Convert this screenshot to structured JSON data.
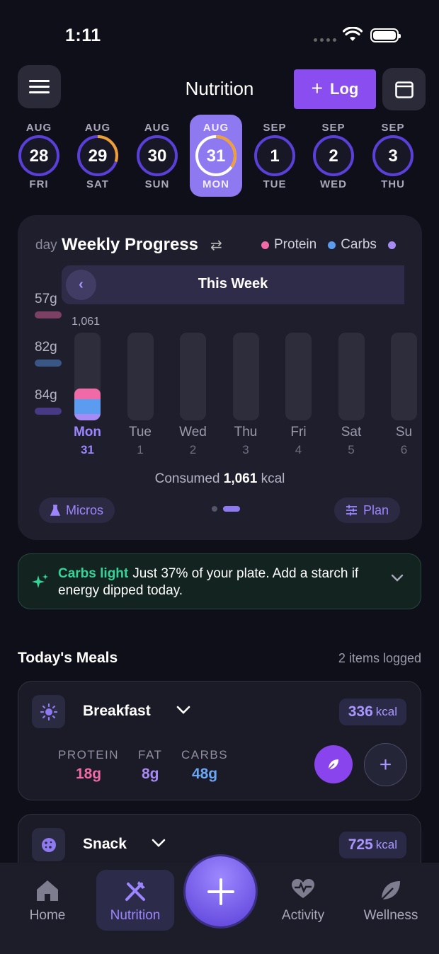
{
  "status_bar": {
    "time": "1:11"
  },
  "header": {
    "title": "Nutrition",
    "log_label": "Log"
  },
  "days": [
    {
      "month": "AUG",
      "day": "28",
      "dow": "FRI",
      "progress": 0.0,
      "active": false
    },
    {
      "month": "AUG",
      "day": "29",
      "dow": "SAT",
      "progress": 0.3,
      "active": false
    },
    {
      "month": "AUG",
      "day": "30",
      "dow": "SUN",
      "progress": 0.0,
      "active": false
    },
    {
      "month": "AUG",
      "day": "31",
      "dow": "MON",
      "progress": 0.35,
      "active": true
    },
    {
      "month": "SEP",
      "day": "1",
      "dow": "TUE",
      "progress": 0.0,
      "active": false
    },
    {
      "month": "SEP",
      "day": "2",
      "dow": "WED",
      "progress": 0.0,
      "active": false
    },
    {
      "month": "SEP",
      "day": "3",
      "dow": "THU",
      "progress": 0.0,
      "active": false
    }
  ],
  "weekly": {
    "cut_label": "day",
    "title": "Weekly Progress",
    "legend": [
      {
        "label": "Protein",
        "color": "#f06aa8"
      },
      {
        "label": "Carbs",
        "color": "#5b9cf0"
      },
      {
        "label": "",
        "color": "#a88af5"
      }
    ],
    "side_values": [
      {
        "label": "57g",
        "color": "#f06aa8"
      },
      {
        "label": "82g",
        "color": "#5b9cf0"
      },
      {
        "label": "84g",
        "color": "#7a5af0"
      }
    ],
    "week_label": "This Week",
    "top_value": "1,061",
    "consumed_prefix": "Consumed",
    "consumed_value": "1,061",
    "consumed_unit": "kcal",
    "micros_label": "Micros",
    "plan_label": "Plan"
  },
  "chart_data": {
    "type": "bar",
    "categories": [
      "Mon",
      "Tue",
      "Wed",
      "Thu",
      "Fri",
      "Sat",
      "Su"
    ],
    "dates": [
      "31",
      "1",
      "2",
      "3",
      "4",
      "5",
      "6"
    ],
    "series": [
      {
        "name": "Protein",
        "values": [
          0.12,
          0,
          0,
          0,
          0,
          0,
          0
        ]
      },
      {
        "name": "Carbs",
        "values": [
          0.17,
          0,
          0,
          0,
          0,
          0,
          0
        ]
      },
      {
        "name": "",
        "values": [
          0.07,
          0,
          0,
          0,
          0,
          0,
          0
        ]
      }
    ],
    "selected": 0
  },
  "tip": {
    "highlight": "Carbs light",
    "text": "Just 37% of your plate. Add a starch if energy dipped today."
  },
  "meals_section": {
    "title": "Today's Meals",
    "meta": "2 items logged"
  },
  "meals": [
    {
      "name": "Breakfast",
      "kcal": "336",
      "kcal_unit": "kcal",
      "macros": [
        {
          "label": "PROTEIN",
          "value": "18g",
          "color": "#f06aa8"
        },
        {
          "label": "FAT",
          "value": "8g",
          "color": "#a88af5"
        },
        {
          "label": "CARBS",
          "value": "48g",
          "color": "#6aa8f5"
        }
      ]
    },
    {
      "name": "Snack",
      "kcal": "725",
      "kcal_unit": "kcal"
    }
  ],
  "tabs": [
    {
      "label": "Home",
      "icon": "home-icon"
    },
    {
      "label": "Nutrition",
      "icon": "utensils-icon"
    },
    {
      "label": "Activity",
      "icon": "heart-pulse-icon"
    },
    {
      "label": "Wellness",
      "icon": "leaf-icon"
    }
  ]
}
